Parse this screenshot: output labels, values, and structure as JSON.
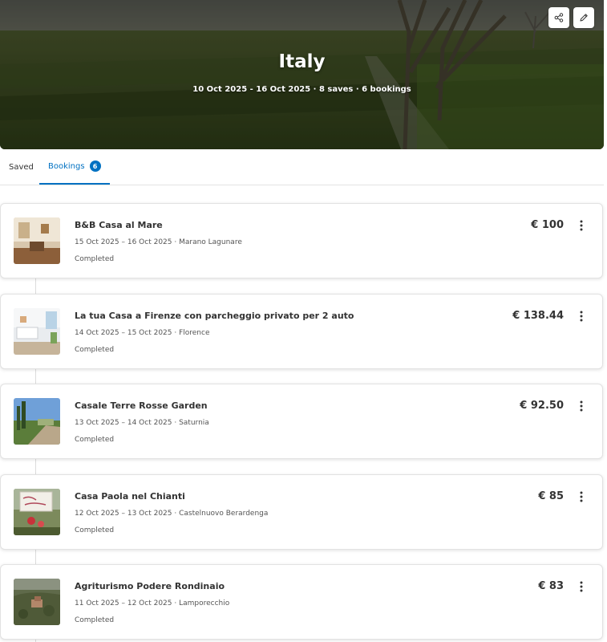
{
  "trip": {
    "title": "Italy",
    "subtitle": "10 Oct 2025 - 16 Oct 2025 · 8 saves · 6 bookings",
    "icons": {
      "share": "share-icon",
      "edit": "pencil-icon"
    }
  },
  "tabs": {
    "saved_label": "Saved",
    "bookings_label": "Bookings",
    "bookings_count": "6"
  },
  "colors": {
    "accent": "#0071c2",
    "text": "#333333",
    "muted": "#555555"
  },
  "bookings": [
    {
      "name": "B&B Casa al Mare",
      "dates": "15 Oct 2025 – 16 Oct 2025 · Marano Lagunare",
      "status": "Completed",
      "price": "€ 100"
    },
    {
      "name": "La tua Casa a Firenze con parcheggio privato per 2 auto",
      "dates": "14 Oct 2025 – 15 Oct 2025 · Florence",
      "status": "Completed",
      "price": "€ 138.44"
    },
    {
      "name": "Casale Terre Rosse Garden",
      "dates": "13 Oct 2025 – 14 Oct 2025 · Saturnia",
      "status": "Completed",
      "price": "€ 92.50"
    },
    {
      "name": "Casa Paola nel Chianti",
      "dates": "12 Oct 2025 – 13 Oct 2025 · Castelnuovo Berardenga",
      "status": "Completed",
      "price": "€ 85"
    },
    {
      "name": "Agriturismo Podere Rondinaio",
      "dates": "11 Oct 2025 – 12 Oct 2025 · Lamporecchio",
      "status": "Completed",
      "price": "€ 83"
    }
  ]
}
